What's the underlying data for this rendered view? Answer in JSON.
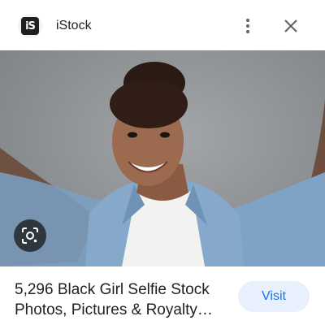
{
  "header": {
    "favicon_text": "iS",
    "site_name": "iStock",
    "more_icon": "more-vert-icon",
    "close_icon": "close-icon"
  },
  "image": {
    "alt": "Smiling young woman with curly hair bun wearing a denim shirt taking a selfie",
    "lens_icon": "google-lens-icon"
  },
  "result": {
    "title_line1": "5,296 Black Girl Selfie Stock",
    "title_line2": "Photos, Pictures & Royalty…",
    "visit_label": "Visit"
  },
  "colors": {
    "visit_bg": "#e8f0fe",
    "visit_text": "#1a73e8",
    "photo_bg": "#8d9093"
  }
}
